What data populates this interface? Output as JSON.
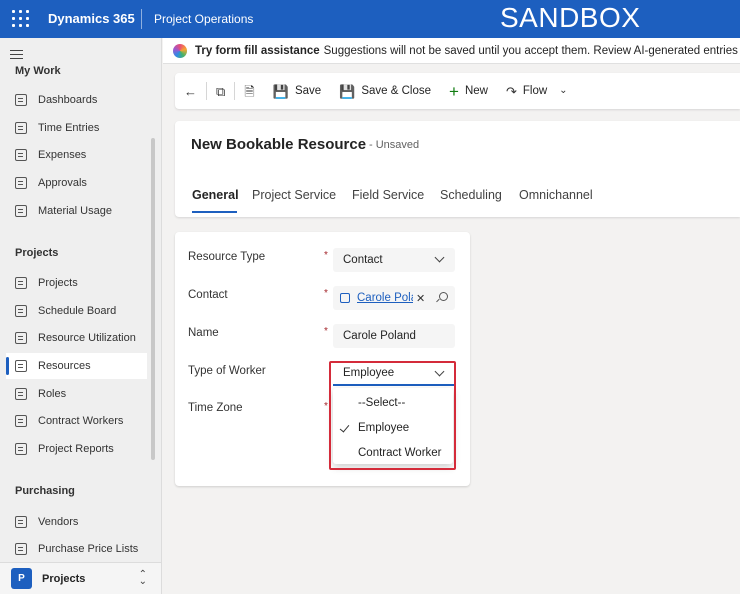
{
  "header": {
    "app_name": "Dynamics 365",
    "module": "Project Operations",
    "environment": "SANDBOX"
  },
  "sidebar": {
    "sections": [
      {
        "title": "My Work"
      },
      {
        "title": "Projects"
      },
      {
        "title": "Purchasing"
      }
    ],
    "items": [
      {
        "label": "Dashboards",
        "icon": "dashboard-icon"
      },
      {
        "label": "Time Entries",
        "icon": "calendar-icon"
      },
      {
        "label": "Expenses",
        "icon": "receipt-icon"
      },
      {
        "label": "Approvals",
        "icon": "document-check-icon"
      },
      {
        "label": "Material Usage",
        "icon": "box-icon"
      },
      {
        "label": "Projects",
        "icon": "board-icon"
      },
      {
        "label": "Schedule Board",
        "icon": "schedule-icon"
      },
      {
        "label": "Resource Utilization",
        "icon": "chart-icon"
      },
      {
        "label": "Resources",
        "icon": "person-search-icon"
      },
      {
        "label": "Roles",
        "icon": "roles-icon"
      },
      {
        "label": "Contract Workers",
        "icon": "contract-icon"
      },
      {
        "label": "Project Reports",
        "icon": "report-icon"
      },
      {
        "label": "Vendors",
        "icon": "vendor-icon"
      },
      {
        "label": "Purchase Price Lists",
        "icon": "database-icon"
      }
    ],
    "active_item": "Resources",
    "area": {
      "badge": "P",
      "label": "Projects"
    }
  },
  "banner": {
    "bold": "Try form fill assistance",
    "text": "Suggestions will not be saved until you accept them. Review AI-generated entries for acc"
  },
  "commandbar": {
    "save": "Save",
    "save_close": "Save & Close",
    "new": "New",
    "flow": "Flow"
  },
  "form": {
    "title": "New Bookable Resource",
    "status": "- Unsaved",
    "tabs": [
      "General",
      "Project Service",
      "Field Service",
      "Scheduling",
      "Omnichannel"
    ],
    "selected_tab": "General",
    "fields": {
      "resource_type": {
        "label": "Resource Type",
        "value": "Contact"
      },
      "contact": {
        "label": "Contact",
        "value": "Carole Pola"
      },
      "name": {
        "label": "Name",
        "value": "Carole Poland"
      },
      "type_of_worker": {
        "label": "Type of Worker",
        "value": "Employee"
      },
      "time_zone": {
        "label": "Time Zone"
      }
    },
    "required_marker": "*",
    "worker_options": [
      {
        "label": "--Select--",
        "selected": false
      },
      {
        "label": "Employee",
        "selected": true
      },
      {
        "label": "Contract Worker",
        "selected": false
      }
    ]
  },
  "colors": {
    "header_bg": "#1d5fbf",
    "accent": "#1d5fbf",
    "highlight": "#d42b3a",
    "required": "#a4262c"
  }
}
